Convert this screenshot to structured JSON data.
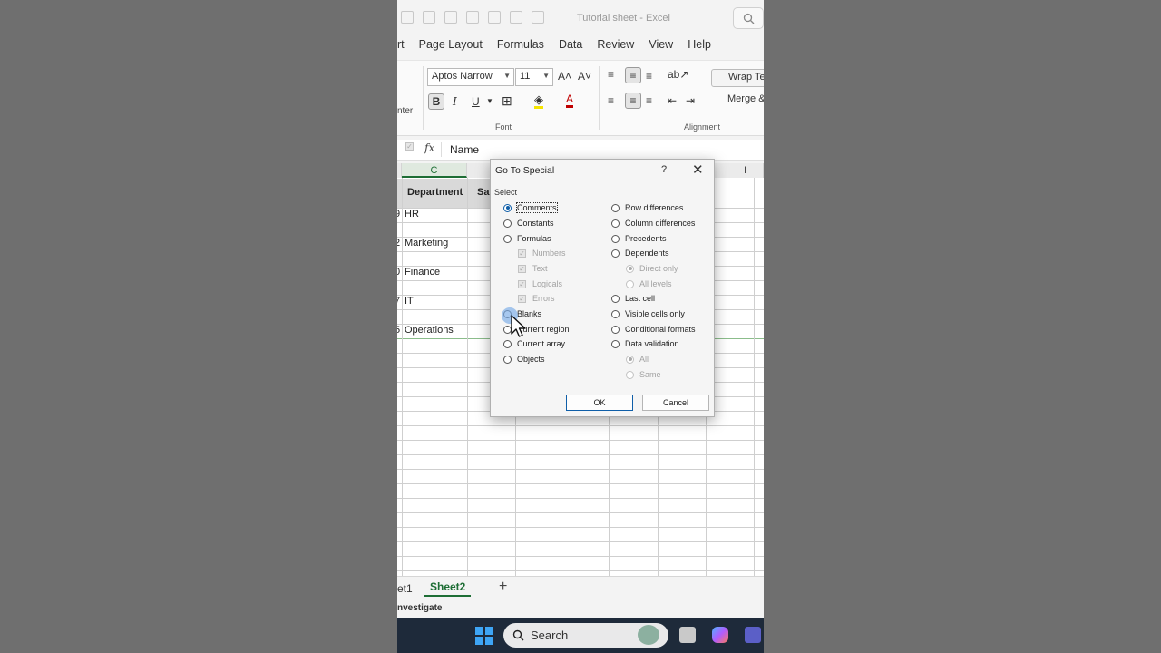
{
  "window": {
    "title": "Tutorial sheet - Excel"
  },
  "menu": [
    "rt",
    "Page Layout",
    "Formulas",
    "Data",
    "Review",
    "View",
    "Help"
  ],
  "ribbon": {
    "left_fragment": "nter",
    "font_name": "Aptos Narrow",
    "font_size": "11",
    "bold": "B",
    "italic": "I",
    "underline": "U",
    "font_color_letter": "A",
    "font_group_label": "Font",
    "alignment_group_label": "Alignment",
    "wrap_text": "Wrap Tex",
    "merge": "Merge &"
  },
  "formula_bar": {
    "fx": "fx",
    "value": "Name"
  },
  "grid": {
    "columns": [
      "C",
      "I"
    ],
    "header_cells": [
      "Department",
      "Sa"
    ],
    "rows": [
      {
        "prefix": "9",
        "department": "HR"
      },
      {
        "prefix": "2",
        "department": "Marketing"
      },
      {
        "prefix": "0",
        "department": "Finance"
      },
      {
        "prefix": "7",
        "department": "IT"
      },
      {
        "prefix": "5",
        "department": "Operations"
      }
    ]
  },
  "sheets": {
    "first": "et1",
    "active": "Sheet2",
    "add": "+"
  },
  "status": "nvestigate",
  "taskbar": {
    "search": "Search"
  },
  "dialog": {
    "title": "Go To Special",
    "help": "?",
    "close": "✕",
    "select_label": "Select",
    "left_options": [
      {
        "label": "Comments",
        "checked": true
      },
      {
        "label": "Constants"
      },
      {
        "label": "Formulas"
      },
      {
        "label": "Numbers",
        "sub": true
      },
      {
        "label": "Text",
        "sub": true
      },
      {
        "label": "Logicals",
        "sub": true
      },
      {
        "label": "Errors",
        "sub": true
      },
      {
        "label": "Blanks"
      },
      {
        "label": "Current region"
      },
      {
        "label": "Current array"
      },
      {
        "label": "Objects"
      }
    ],
    "right_options": [
      {
        "label": "Row differences"
      },
      {
        "label": "Column differences"
      },
      {
        "label": "Precedents"
      },
      {
        "label": "Dependents"
      },
      {
        "label": "Direct only",
        "sub": true,
        "checked": true
      },
      {
        "label": "All levels",
        "sub": true
      },
      {
        "label": "Last cell"
      },
      {
        "label": "Visible cells only"
      },
      {
        "label": "Conditional formats"
      },
      {
        "label": "Data validation"
      },
      {
        "label": "All",
        "sub": true,
        "checked": true
      },
      {
        "label": "Same",
        "sub": true
      }
    ],
    "ok": "OK",
    "cancel": "Cancel"
  }
}
